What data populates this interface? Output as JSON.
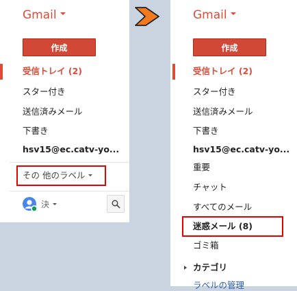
{
  "left_panel": {
    "title": "Gmail",
    "compose_label": "作成",
    "items": [
      {
        "label": "受信トレイ (2)"
      },
      {
        "label": "スター付き"
      },
      {
        "label": "送信済みメール"
      },
      {
        "label": "下書き"
      },
      {
        "label": "hsv15@ec.catv-yo..."
      }
    ],
    "more_labels": "その 他のラベル",
    "user_name": "決"
  },
  "right_panel": {
    "title": "Gmail",
    "compose_label": "作成",
    "items": [
      {
        "label": "受信トレイ (2)"
      },
      {
        "label": "スター付き"
      },
      {
        "label": "送信済みメール"
      },
      {
        "label": "下書き"
      },
      {
        "label": "hsv15@ec.catv-yo..."
      },
      {
        "label": "重要"
      },
      {
        "label": "チャット"
      },
      {
        "label": "すべてのメール"
      },
      {
        "label": "迷惑メール (8)"
      },
      {
        "label": "ゴミ箱"
      },
      {
        "label": "カテゴリ"
      },
      {
        "label": "ラベルの管理"
      }
    ]
  },
  "icons": {
    "arrow": "right-arrow-icon",
    "avatar": "user-avatar-icon",
    "search": "search-icon",
    "presence": "online-status-icon",
    "dropdown": "chevron-down-icon",
    "expand": "triangle-right-icon"
  },
  "colors": {
    "accent": "#dd4b39",
    "compose_button": "#d14836",
    "highlight_box": "#e60000",
    "arrow_fill": "#f47a20",
    "background": "#c9d4e0",
    "avatar": "#4a86e8",
    "presence": "#0f9d58"
  }
}
